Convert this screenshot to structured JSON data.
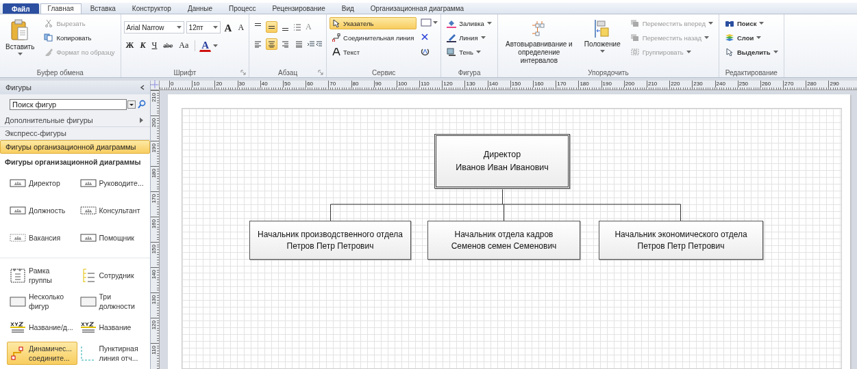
{
  "tabs": [
    {
      "label": "Файл",
      "kind": "file",
      "selected": false
    },
    {
      "label": "Главная",
      "kind": "tab",
      "selected": true
    },
    {
      "label": "Вставка",
      "kind": "tab",
      "selected": false
    },
    {
      "label": "Конструктор",
      "kind": "tab",
      "selected": false
    },
    {
      "label": "Данные",
      "kind": "tab",
      "selected": false
    },
    {
      "label": "Процесс",
      "kind": "tab",
      "selected": false
    },
    {
      "label": "Рецензирование",
      "kind": "tab",
      "selected": false
    },
    {
      "label": "Вид",
      "kind": "tab",
      "selected": false
    },
    {
      "label": "Организационная диаграмма",
      "kind": "tab",
      "selected": false
    }
  ],
  "ribbon": {
    "clipboard": {
      "title": "Буфер обмена",
      "paste": "Вставить",
      "items": [
        {
          "label": "Вырезать",
          "disabled": true
        },
        {
          "label": "Копировать",
          "disabled": false
        },
        {
          "label": "Формат по образцу",
          "disabled": true
        }
      ]
    },
    "font": {
      "title": "Шрифт",
      "font_name": "Arial Narrow",
      "font_size": "12пт",
      "grow": "A",
      "shrink": "A",
      "styles": [
        "Ж",
        "К",
        "Ч",
        "abe",
        "Aa"
      ],
      "color_letter": "A"
    },
    "paragraph": {
      "title": "Абзац",
      "row_1": [
        {
          "selected": false
        },
        {
          "selected": true
        },
        {
          "selected": false
        }
      ],
      "row_2": [
        {
          "selected": false
        },
        {
          "selected": true
        },
        {
          "selected": false
        },
        {
          "selected": false
        }
      ],
      "text_style": "A"
    },
    "tools": {
      "title": "Сервис",
      "items": [
        {
          "label": "Указатель",
          "selected": true
        },
        {
          "label": "Соединительная линия",
          "selected": false
        },
        {
          "label": "Текст",
          "selected": false
        }
      ]
    },
    "shape": {
      "title": "Фигура",
      "items": [
        {
          "label": "Заливка"
        },
        {
          "label": "Линия"
        },
        {
          "label": "Тень"
        }
      ]
    },
    "arrange": {
      "title": "Упорядочить",
      "auto_align": "Автовыравнивание и определение интервалов",
      "position": "Положение",
      "items": [
        {
          "label": "Переместить вперед",
          "disabled": true
        },
        {
          "label": "Переместить назад",
          "disabled": true
        },
        {
          "label": "Группировать",
          "disabled": true
        }
      ]
    },
    "editing": {
      "title": "Редактирование",
      "items": [
        {
          "label": "Поиск"
        },
        {
          "label": "Слои"
        },
        {
          "label": "Выделить"
        }
      ]
    }
  },
  "shapes_panel": {
    "title": "Фигуры",
    "search": {
      "placeholder": "Поиск фигур"
    },
    "sections": [
      {
        "label": "Дополнительные фигуры",
        "kind": "submenu",
        "selected": false
      },
      {
        "label": "Экспресс-фигуры",
        "kind": "plain",
        "selected": false
      },
      {
        "label": "Фигуры организационной диаграммы",
        "kind": "plain",
        "selected": true
      }
    ],
    "stencil_title": "Фигуры организационной диаграммы",
    "shape_groups": [
      [
        {
          "label": "Директор",
          "selected": false
        },
        {
          "label": "Руководите...",
          "selected": false
        },
        {
          "label": "Должность",
          "selected": false
        },
        {
          "label": "Консультант",
          "selected": false
        },
        {
          "label": "Вакансия",
          "selected": false
        },
        {
          "label": "Помощник",
          "selected": false
        }
      ],
      [
        {
          "label": "Рамка группы",
          "selected": false
        },
        {
          "label": "Сотрудник",
          "selected": false
        },
        {
          "label": "Несколько фигур",
          "selected": false
        },
        {
          "label": "Три должности",
          "selected": false
        },
        {
          "label": "Название/д...",
          "selected": false
        },
        {
          "label": "Название",
          "selected": false
        },
        {
          "label": "Динамичес... соедините...",
          "selected": true
        },
        {
          "label": "Пунктирная линия отч...",
          "selected": false
        }
      ]
    ]
  },
  "rulers": {
    "horizontal": [
      "0",
      "10",
      "20",
      "30",
      "40",
      "50",
      "60",
      "70",
      "80",
      "90",
      "100",
      "110",
      "120",
      "130",
      "140",
      "150",
      "160",
      "170",
      "180",
      "190",
      "200",
      "210",
      "220",
      "230",
      "240",
      "250",
      "260",
      "270",
      "280",
      "290"
    ],
    "vertical": [
      "210",
      "200",
      "190",
      "180",
      "170",
      "160",
      "150",
      "140",
      "130",
      "120",
      "110"
    ]
  },
  "org_chart": {
    "head": {
      "title": "Директор",
      "name": "Иванов Иван Иванович"
    },
    "subordinates": [
      {
        "title": "Начальник производственного отдела",
        "name": "Петров Петр Петрович"
      },
      {
        "title": "Начальник отдела кадров",
        "name": "Семенов семен Семенович"
      },
      {
        "title": "Начальник экономического отдела",
        "name": "Петров Петр Петрович"
      }
    ]
  }
}
